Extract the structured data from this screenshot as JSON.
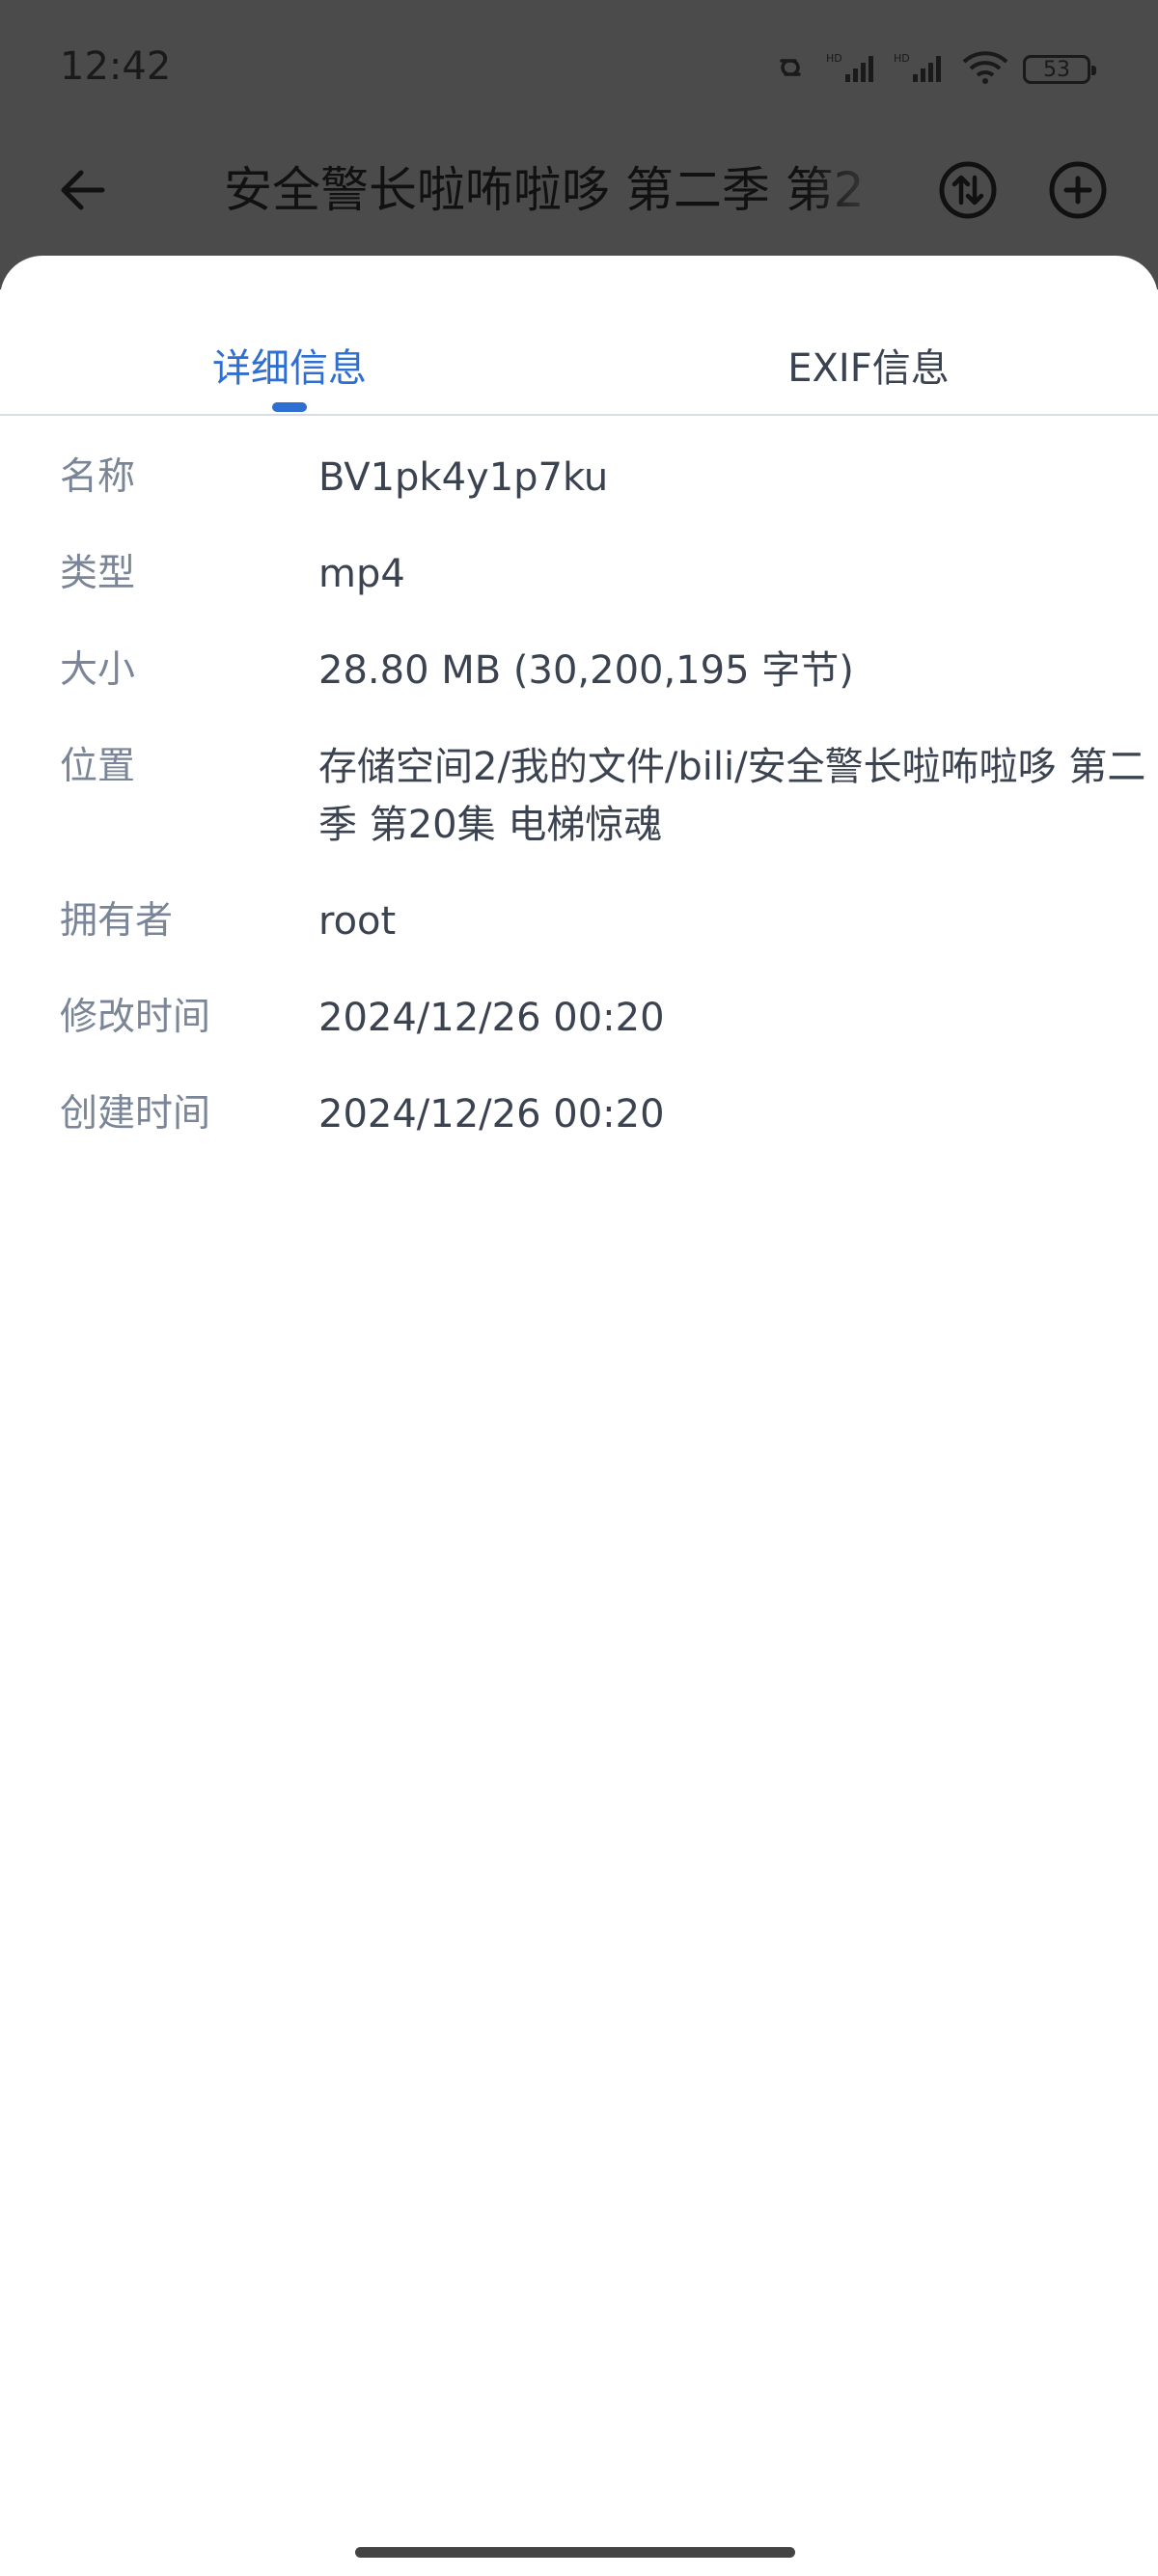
{
  "status_bar": {
    "time": "12:42",
    "battery": "53",
    "icons": [
      "link-icon",
      "signal-hd-icon",
      "signal-hd-icon",
      "wifi-icon",
      "battery-icon"
    ]
  },
  "app_bar": {
    "title": "安全警长啦咘啦哆 第二季 第2",
    "icons": [
      "back-arrow-icon",
      "sort-icon",
      "add-icon"
    ]
  },
  "tabs": [
    {
      "label": "详细信息",
      "active": true
    },
    {
      "label": "EXIF信息",
      "active": false
    }
  ],
  "details": [
    {
      "label": "名称",
      "value": "BV1pk4y1p7ku"
    },
    {
      "label": "类型",
      "value": "mp4"
    },
    {
      "label": "大小",
      "value": "28.80 MB (30,200,195 字节)"
    },
    {
      "label": "位置",
      "value": "存储空间2/我的文件/bili/安全警长啦咘啦哆 第二季 第20集 电梯惊魂"
    },
    {
      "label": "拥有者",
      "value": "root"
    },
    {
      "label": "修改时间",
      "value": "2024/12/26 00:20"
    },
    {
      "label": "创建时间",
      "value": "2024/12/26 00:20"
    }
  ],
  "colors": {
    "accent": "#2f6fd1",
    "label": "#7a8597",
    "value": "#3c4350",
    "scrim": "#4b4b4b"
  }
}
